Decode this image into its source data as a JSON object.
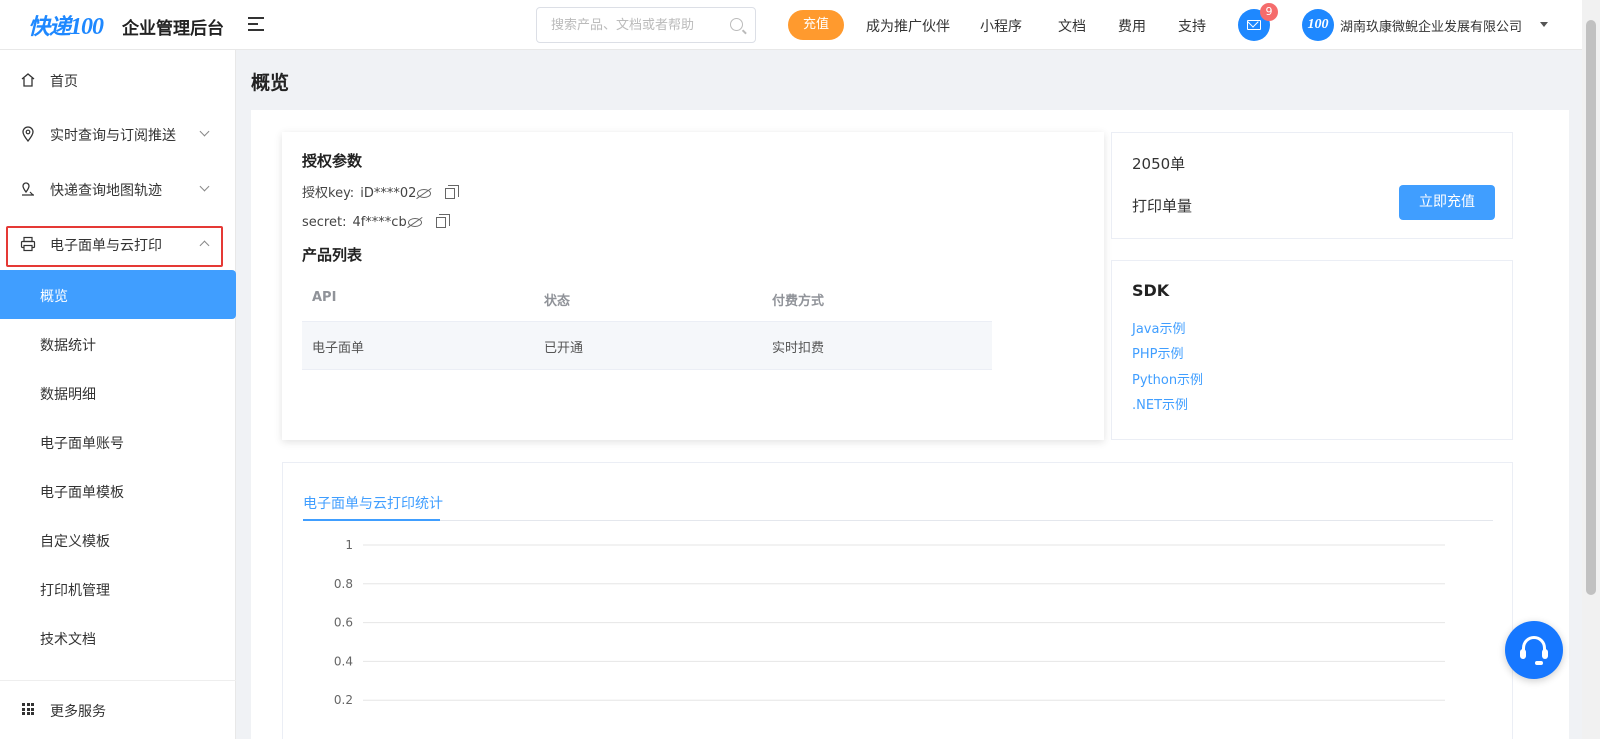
{
  "header": {
    "logo_text": "快递",
    "logo_num": "100",
    "app_title": "企业管理后台",
    "search_placeholder": "搜索产品、文档或者帮助",
    "recharge_label": "充值",
    "nav": [
      "成为推广伙伴",
      "小程序",
      "文档",
      "费用",
      "支持"
    ],
    "mail_badge": "9",
    "avatar_text": "100",
    "company": "湖南玖康微鲵企业发展有限公司"
  },
  "sidebar": {
    "items": [
      {
        "label": "首页",
        "icon": "home-icon"
      },
      {
        "label": "实时查询与订阅推送",
        "icon": "location-pin-icon"
      },
      {
        "label": "快递查询地图轨迹",
        "icon": "map-route-icon"
      },
      {
        "label": "电子面单与云打印",
        "icon": "printer-icon"
      }
    ],
    "sub_items": [
      "概览",
      "数据统计",
      "数据明细",
      "电子面单账号",
      "电子面单模板",
      "自定义模板",
      "打印机管理",
      "技术文档"
    ],
    "active_sub": "概览",
    "more_label": "更多服务"
  },
  "page_title": "概览",
  "auth": {
    "title": "授权参数",
    "key_label": "授权key:",
    "key_value": "iD****02",
    "secret_label": "secret:",
    "secret_value": "4f****cb"
  },
  "products": {
    "title": "产品列表",
    "columns": [
      "API",
      "状态",
      "付费方式"
    ],
    "rows": [
      [
        "电子面单",
        "已开通",
        "实时扣费"
      ]
    ]
  },
  "quota": {
    "count": "2050单",
    "label": "打印单量",
    "button": "立即充值"
  },
  "sdk": {
    "title": "SDK",
    "links": [
      "Java示例",
      "PHP示例",
      "Python示例",
      ".NET示例"
    ]
  },
  "stats": {
    "tab_label": "电子面单与云打印统计"
  },
  "chart_data": {
    "type": "line",
    "title": "",
    "series": [],
    "y_ticks": [
      "1",
      "0.8",
      "0.6",
      "0.4",
      "0.2"
    ],
    "ylim": [
      0,
      1
    ],
    "grid": true
  },
  "colors": {
    "primary": "#409eff",
    "brand": "#1e88ff",
    "recharge": "#ff9a2e",
    "badge": "#f56c6c",
    "highlight": "#e53935"
  }
}
